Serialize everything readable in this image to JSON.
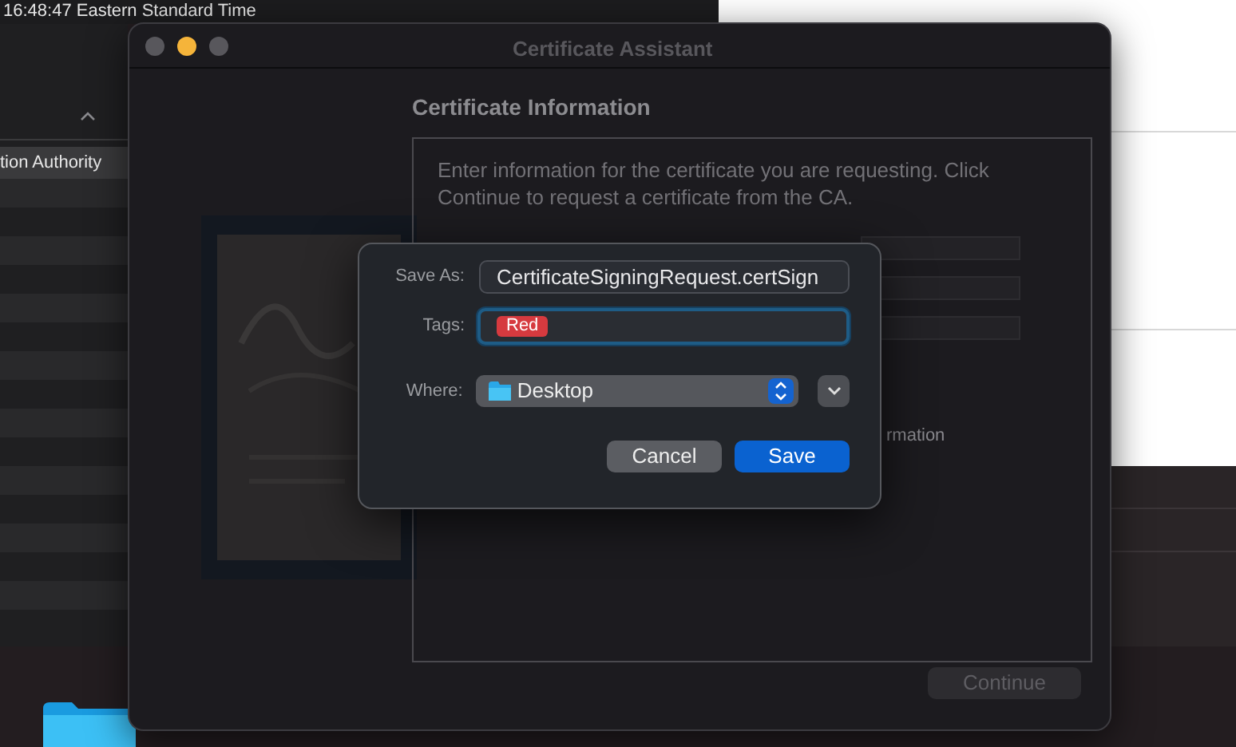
{
  "menubar_clock": "16:48:47 Eastern Standard Time",
  "background_app": {
    "selected_row": "tion Authority"
  },
  "window": {
    "title": "Certificate Assistant",
    "traffic_lights": [
      {
        "color": "#58575c"
      },
      {
        "color": "#f5b43a"
      },
      {
        "color": "#58575c"
      }
    ],
    "heading": "Certificate Information",
    "instructions": "Enter information for the certificate you are requesting. Click Continue to request a certificate from the CA.",
    "partial_label": "rmation",
    "continue_button": {
      "label": "Continue",
      "disabled": true
    }
  },
  "save_sheet": {
    "save_as": {
      "label": "Save As:",
      "value": "CertificateSigningRequest.certSign"
    },
    "tags": {
      "label": "Tags:",
      "focused": true,
      "items": [
        {
          "label": "Red",
          "color": "#d63a3f"
        }
      ]
    },
    "where": {
      "label": "Where:",
      "value": "Desktop"
    },
    "buttons": [
      {
        "label": "Cancel",
        "kind": "secondary"
      },
      {
        "label": "Save",
        "kind": "primary"
      }
    ]
  }
}
